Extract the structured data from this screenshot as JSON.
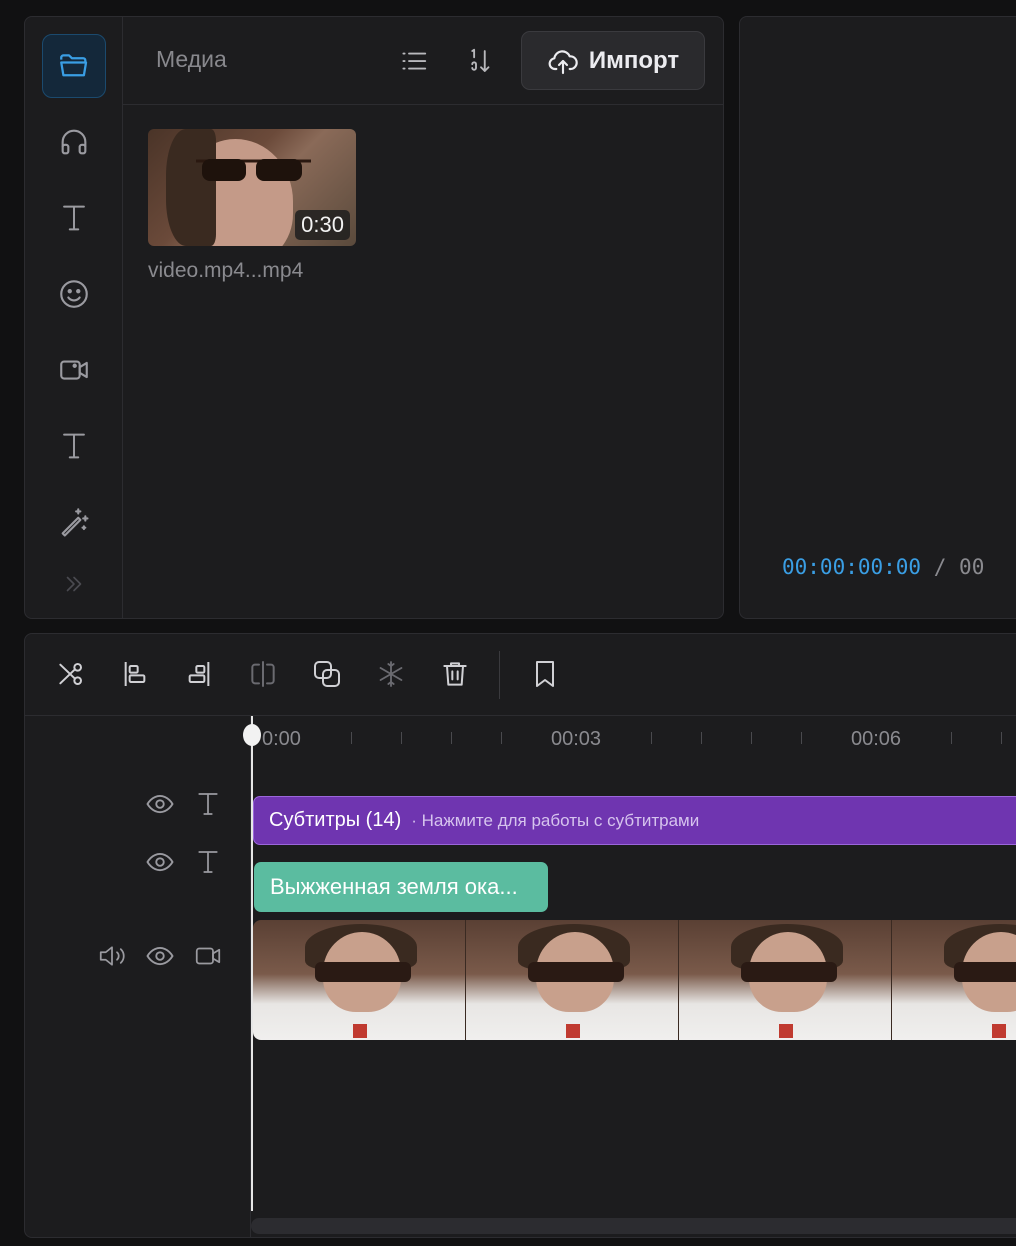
{
  "media": {
    "title": "Медиа",
    "import_label": "Импорт",
    "item": {
      "duration": "0:30",
      "file_name": "video.mp4...mp4"
    }
  },
  "preview": {
    "current_time": "00:00:00:00",
    "separator": "/",
    "total_time": "00"
  },
  "timeline": {
    "ruler": [
      "0:00",
      "00:03",
      "00:06"
    ],
    "subtitle_track": {
      "label": "Субтитры (14)",
      "hint": "· Нажмите для работы с субтитрами"
    },
    "text_clip": "Выжженная земля ока..."
  },
  "colors": {
    "accent": "#3a9ee4",
    "subtitle_clip": "#6f35b0",
    "text_clip": "#5bbca0"
  },
  "icons": {
    "sidebar": [
      "folder-icon",
      "headphones-icon",
      "text-icon",
      "smiley-icon",
      "video-camera-icon",
      "text-icon",
      "magic-wand-icon",
      "chevron-double-right-icon"
    ],
    "media_header": [
      "list-icon",
      "sort-icon",
      "cloud-upload-icon"
    ],
    "timeline_tools": [
      "split-icon",
      "align-left-icon",
      "align-right-icon",
      "trim-icon",
      "duplicate-icon",
      "freeze-icon",
      "trash-icon",
      "bookmark-icon"
    ],
    "track_headers": [
      "eye-icon",
      "text-icon",
      "speaker-icon",
      "video-camera-icon"
    ]
  }
}
